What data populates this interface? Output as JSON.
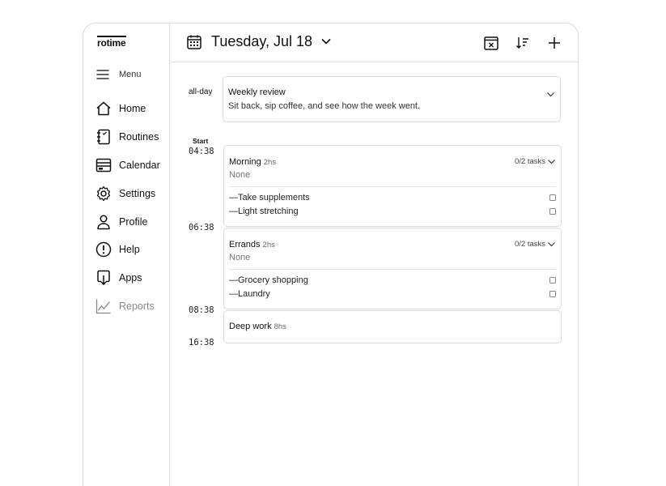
{
  "app": {
    "logo": "rotime"
  },
  "sidebar": {
    "menu_label": "Menu",
    "items": [
      {
        "label": "Home",
        "icon": "home-icon"
      },
      {
        "label": "Routines",
        "icon": "routines-icon"
      },
      {
        "label": "Calendar",
        "icon": "calendar-icon"
      },
      {
        "label": "Settings",
        "icon": "gear-icon"
      },
      {
        "label": "Profile",
        "icon": "user-icon"
      },
      {
        "label": "Help",
        "icon": "help-icon"
      },
      {
        "label": "Apps",
        "icon": "apps-icon"
      },
      {
        "label": "Reports",
        "icon": "chart-icon",
        "muted": true
      }
    ]
  },
  "header": {
    "date": "Tuesday, Jul 18",
    "icons": [
      "calendar-icon",
      "chevron-down-icon",
      "calendar-clear-icon",
      "sort-icon",
      "plus-icon"
    ]
  },
  "schedule": {
    "allday_label": "all-day",
    "start_label": "Start",
    "allday_event": {
      "title": "Weekly review",
      "description": "Sit back, sip coffee, and see how the week went."
    },
    "times": [
      "04:38",
      "06:38",
      "08:38",
      "16:38"
    ],
    "routines": [
      {
        "title": "Morning",
        "duration": "2hs",
        "note": "None",
        "tasks_summary": "0/2 tasks",
        "tasks": [
          "—Take supplements",
          "—Light stretching"
        ]
      },
      {
        "title": "Errands",
        "duration": "2hs",
        "note": "None",
        "tasks_summary": "0/2 tasks",
        "tasks": [
          "—Grocery shopping",
          "—Laundry"
        ]
      },
      {
        "title": "Deep work",
        "duration": "8hs"
      }
    ]
  }
}
